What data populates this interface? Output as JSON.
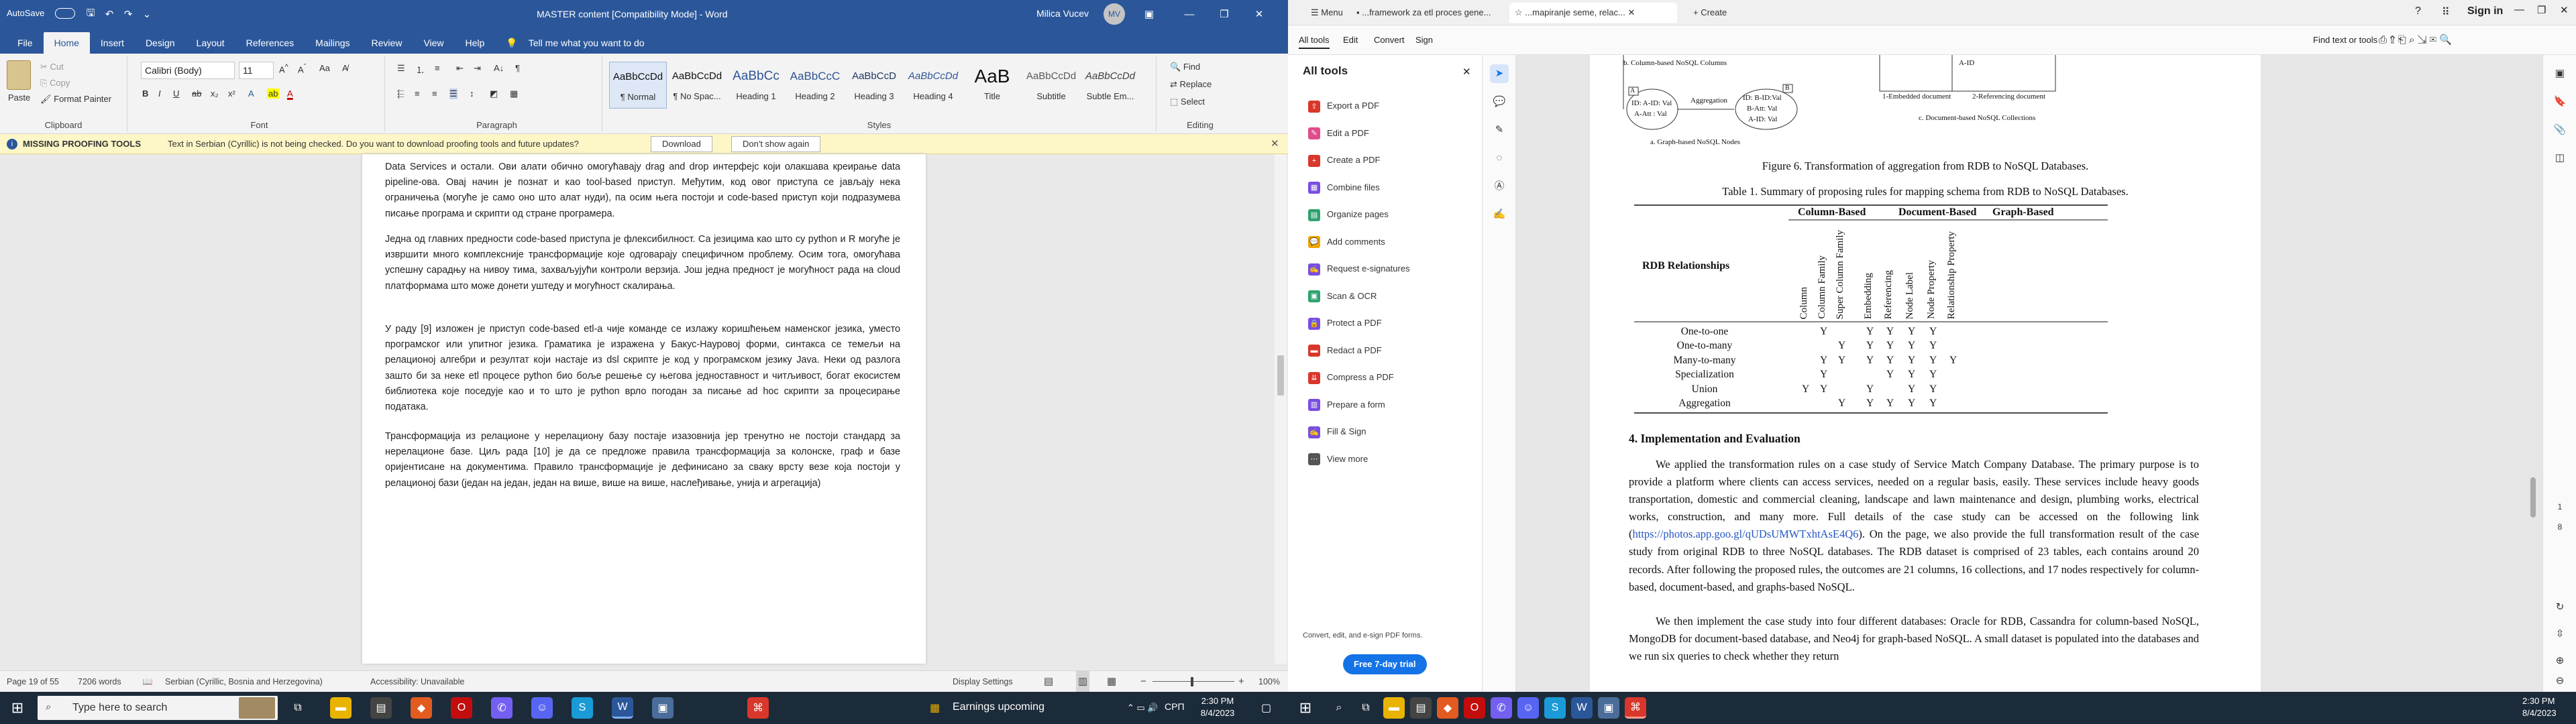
{
  "word": {
    "title_bar": {
      "autosave": "AutoSave",
      "doc_title": "MASTER content [Compatibility Mode] - Word",
      "user": "Milica Vucev",
      "user_initials": "MV"
    },
    "ribbon_tabs": [
      "File",
      "Home",
      "Insert",
      "Design",
      "Layout",
      "References",
      "Mailings",
      "Review",
      "View",
      "Help"
    ],
    "tell_me": "Tell me what you want to do",
    "clipboard": {
      "paste": "Paste",
      "cut": "Cut",
      "copy": "Copy",
      "format_painter": "Format Painter",
      "label": "Clipboard"
    },
    "font": {
      "name": "Calibri (Body)",
      "size": "11",
      "label": "Font"
    },
    "paragraph_label": "Paragraph",
    "styles": [
      {
        "preview": "AaBbCcDd",
        "name": "¶ Normal"
      },
      {
        "preview": "AaBbCcDd",
        "name": "¶ No Spac..."
      },
      {
        "preview": "AaBbCc",
        "name": "Heading 1"
      },
      {
        "preview": "AaBbCcC",
        "name": "Heading 2"
      },
      {
        "preview": "AaBbCcD",
        "name": "Heading 3"
      },
      {
        "preview": "AaBbCcDd",
        "name": "Heading 4"
      },
      {
        "preview": "AaB",
        "name": "Title"
      },
      {
        "preview": "AaBbCcDd",
        "name": "Subtitle"
      },
      {
        "preview": "AaBbCcDd",
        "name": "Subtle Em..."
      }
    ],
    "styles_label": "Styles",
    "editing": {
      "find": "Find",
      "replace": "Replace",
      "select": "Select",
      "label": "Editing"
    },
    "message_bar": {
      "title": "MISSING PROOFING TOOLS",
      "text": "Text in Serbian (Cyrillic) is not being checked. Do you want to download proofing tools and future updates?",
      "download": "Download",
      "dont_show": "Don't show again"
    },
    "paragraphs": [
      "Data Services и остали. Ови алати обично омогућавају drag and drop интерфејс који олакшава креирање data pipeline-ова. Овај начин је познат и као tool-based приступ. Међутим, код овог приступа се јављају нека ограничења (могуће је само оно што алат нуди), па осим њега постоји и code-based приступ који подразумева писање програма и скрипти од стране програмера.",
      "Једна од главних предности code-based приступа је флексибилност. Са језицима као што су python и R могуће је извршити много комплексније трансформације које одговарају специфичном проблему. Осим тога, омогућава успешну сарадњу на нивоу тима, захваљујући контроли верзија. Још једна предност је могућност рада на cloud платформама што може донети уштеду и могућност скалирања.",
      "У раду [9] изложен је приступ code-based etl-а чије команде се излажу коришћењем наменског језика, уместо програмског или упитног језика. Граматика је изражена у Бакус-Науровој форми, синтакса се темељи на релационој алгебри и резултат који настаје из dsl скрипте је код у програмском језику Java. Неки од разлога зашто би за неке etl процесе python био боље решење су његова једноставност и читљивост, богат екосистем библиотека које поседује као и то што је python врло погодан за писање ad hoc скрипти за процесирање података.",
      "Трансформација из релационе у нерелациону базу постаје изазовнија јер тренутно не постоји стандард за нерелационе базе. Циљ рада [10] је да се предложе правила трансформација за колонске, граф и базе оријентисане на документима. Правило трансформације је дефинисано за сваку врсту везе која постоји у релационој бази (један на један, један на више, више на више, наслеђивање, унија и агрегација)"
    ],
    "status": {
      "page": "Page 19 of 55",
      "words": "7206 words",
      "language": "Serbian (Cyrillic, Bosnia and Herzegovina)",
      "accessibility": "Accessibility: Unavailable",
      "display": "Display Settings",
      "zoom": "100%"
    }
  },
  "taskbar_left": {
    "search_placeholder": "Type here to search",
    "weather": "Earnings upcoming",
    "lang": "СРП",
    "time": "2:30 PM",
    "date": "8/4/2023"
  },
  "taskbar_right": {
    "time": "2:30 PM",
    "date": "8/4/2023"
  },
  "acrobat": {
    "tabs": [
      {
        "label": "Menu"
      },
      {
        "label": "...framework za etl proces gene..."
      },
      {
        "label": "...mapiranje seme, relac..."
      },
      {
        "label": "+ Create"
      }
    ],
    "signin": "Sign in",
    "menubar": [
      "All tools",
      "Edit",
      "Convert",
      "Sign"
    ],
    "find_text": "Find text or tools",
    "panel_title": "All tools",
    "tools": [
      {
        "label": "Export a PDF",
        "color": "#d9372b"
      },
      {
        "label": "Edit a PDF",
        "color": "#e04d8a"
      },
      {
        "label": "Create a PDF",
        "color": "#d9372b"
      },
      {
        "label": "Combine files",
        "color": "#7a4ee0"
      },
      {
        "label": "Organize pages",
        "color": "#2fa36f"
      },
      {
        "label": "Add comments",
        "color": "#f0a500"
      },
      {
        "label": "Request e-signatures",
        "color": "#7a4ee0"
      },
      {
        "label": "Scan & OCR",
        "color": "#2fa36f"
      },
      {
        "label": "Protect a PDF",
        "color": "#7a4ee0"
      },
      {
        "label": "Redact a PDF",
        "color": "#d9372b"
      },
      {
        "label": "Compress a PDF",
        "color": "#d9372b"
      },
      {
        "label": "Prepare a form",
        "color": "#7a4ee0"
      },
      {
        "label": "Fill & Sign",
        "color": "#7a4ee0"
      },
      {
        "label": "View more",
        "color": "#555555"
      }
    ],
    "promo_text": "Convert, edit, and e-sign PDF forms.",
    "trial_button": "Free 7-day trial",
    "page_numbers": [
      "1",
      "8"
    ],
    "doc": {
      "fig_labels": {
        "b_label": "b. Column-based NoSQL Columns",
        "a_label": "a. Graph-based NoSQL Nodes",
        "emb": "1-Embedded document",
        "ref": "2-Referencing document",
        "c_label": "c. Document-based NoSQL Collections",
        "aggregation": "Aggregation",
        "node_a": "ID: A-ID: Val",
        "node_a2": "A-Att : Val",
        "node_b": "ID: B-ID:Val",
        "node_b2": "B-Att: Val",
        "node_b3": "A-ID: Val",
        "box_a": "A",
        "box_b": "B",
        "doc_frag": "A-ID"
      },
      "fig6_caption": "Figure 6. Transformation of aggregation from RDB to NoSQL Databases.",
      "table_caption": "Table 1. Summary of proposing rules for mapping schema from RDB to NoSQL Databases.",
      "table": {
        "groups": [
          "Column-Based",
          "Document-Based",
          "Graph-Based"
        ],
        "row_header": "RDB Relationships",
        "columns": [
          "Column",
          "Column Family",
          "Super Column Family",
          "Embedding",
          "Referencing",
          "Node Label",
          "Node Property",
          "Relationship Property"
        ],
        "rows": [
          {
            "name": "One-to-one",
            "cells": [
              "",
              "Y",
              "",
              "Y",
              "Y",
              "Y",
              "Y",
              ""
            ]
          },
          {
            "name": "One-to-many",
            "cells": [
              "",
              "",
              "Y",
              "Y",
              "Y",
              "Y",
              "Y",
              ""
            ]
          },
          {
            "name": "Many-to-many",
            "cells": [
              "",
              "Y",
              "Y",
              "Y",
              "Y",
              "Y",
              "Y",
              "Y"
            ]
          },
          {
            "name": "Specialization",
            "cells": [
              "",
              "Y",
              "",
              "",
              "Y",
              "Y",
              "Y",
              ""
            ]
          },
          {
            "name": "Union",
            "cells": [
              "Y",
              "Y",
              "",
              "Y",
              "",
              "Y",
              "Y",
              ""
            ]
          },
          {
            "name": "Aggregation",
            "cells": [
              "",
              "",
              "Y",
              "Y",
              "Y",
              "Y",
              "Y",
              ""
            ]
          }
        ]
      },
      "section_title": "4. Implementation and Evaluation",
      "p1": "We applied the transformation rules on a case study of Service Match Company Database. The primary purpose is to provide a platform where clients can access services, needed on a regular basis, easily. These services include heavy goods transportation, domestic and commercial cleaning, landscape and lawn maintenance and design, plumbing works, electrical works, construction, and many more. Full details of the case study can be accessed on the following link (",
      "p1_link": "https://photos.app.goo.gl/qUDsUMWTxhtAsE4Q6",
      "p1_end": "). On the page, we also provide the full transformation result of the case study from original RDB to three NoSQL databases. The RDB dataset is comprised of 23 tables, each contains around 20 records. After following the proposed rules, the outcomes are 21 columns, 16 collections, and 17 nodes respectively for column-based, document-based, and graphs-based NoSQL.",
      "p2": "We then implement the case study into four different databases: Oracle for RDB, Cassandra for column-based NoSQL, MongoDB for document-based database, and Neo4j for graph-based NoSQL. A small dataset is populated into the databases and we run six queries to check whether they return"
    }
  },
  "colors": {
    "word_blue": "#2b579a",
    "taskbar": "#1c2b3a",
    "acrobat_red": "#d9372b",
    "trial_blue": "#1473e6"
  }
}
